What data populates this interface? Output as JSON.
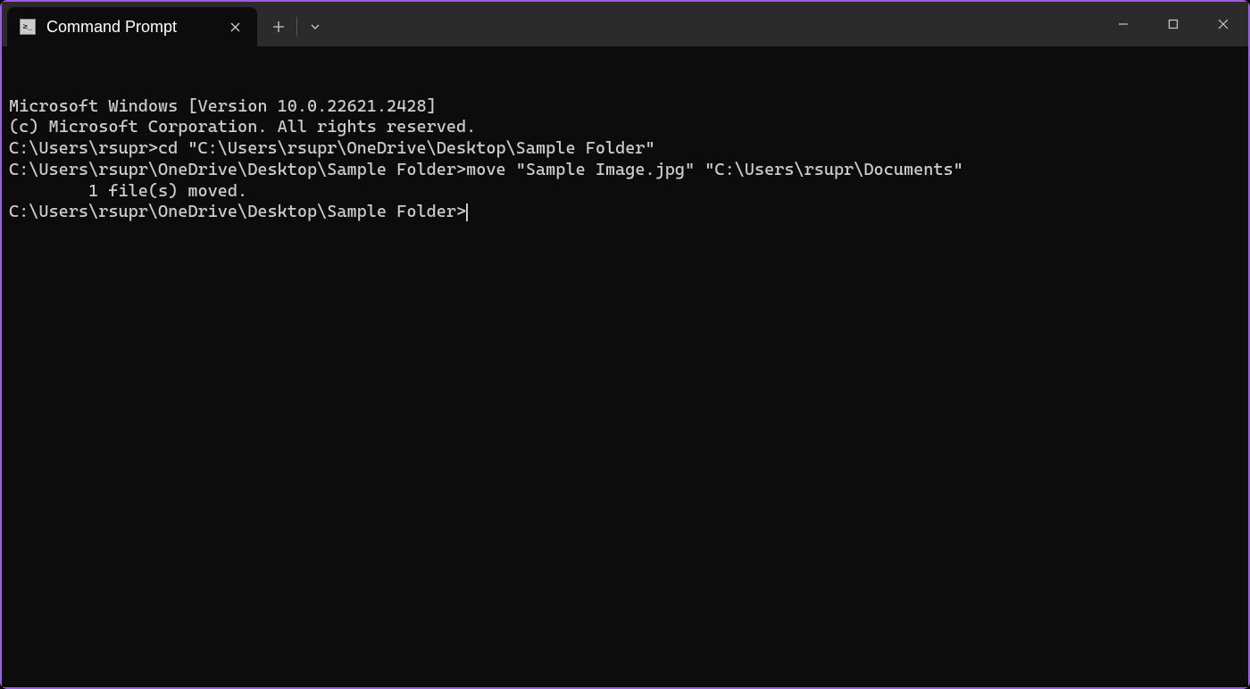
{
  "tab": {
    "title": "Command Prompt"
  },
  "terminal": {
    "lines": [
      "Microsoft Windows [Version 10.0.22621.2428]",
      "(c) Microsoft Corporation. All rights reserved.",
      "",
      "C:\\Users\\rsupr>cd \"C:\\Users\\rsupr\\OneDrive\\Desktop\\Sample Folder\"",
      "",
      "C:\\Users\\rsupr\\OneDrive\\Desktop\\Sample Folder>move \"Sample Image.jpg\" \"C:\\Users\\rsupr\\Documents\"",
      "        1 file(s) moved.",
      "",
      "C:\\Users\\rsupr\\OneDrive\\Desktop\\Sample Folder>"
    ]
  }
}
